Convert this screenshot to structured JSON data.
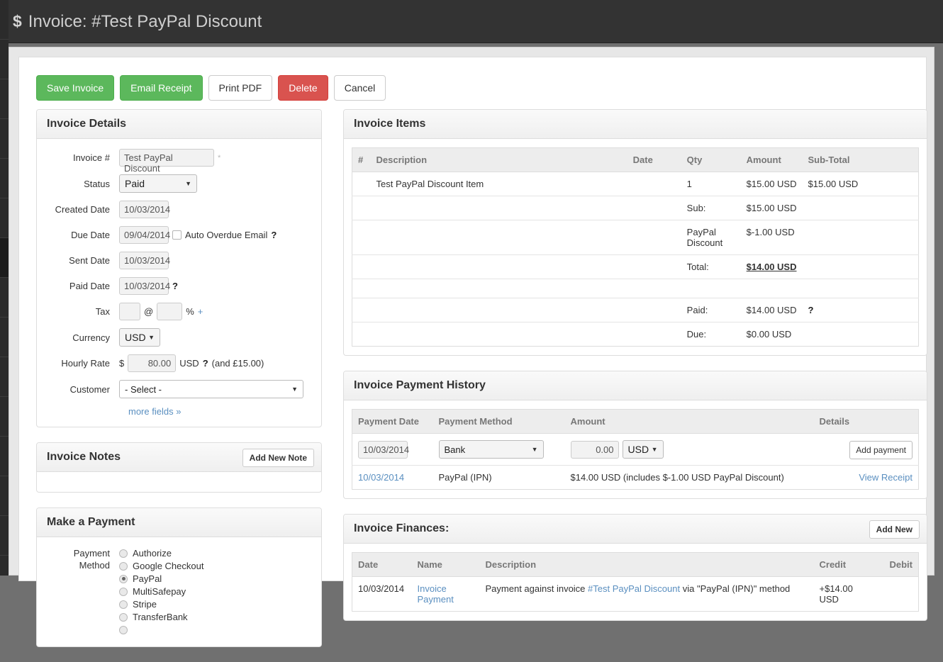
{
  "header": {
    "icon": "dollar-icon",
    "title": "Invoice: #Test PayPal Discount"
  },
  "toolbar": {
    "save_label": "Save Invoice",
    "email_label": "Email Receipt",
    "print_label": "Print PDF",
    "delete_label": "Delete",
    "cancel_label": "Cancel"
  },
  "invoice_details": {
    "panel_title": "Invoice Details",
    "labels": {
      "invoice_no": "Invoice #",
      "status": "Status",
      "created_date": "Created Date",
      "due_date": "Due Date",
      "sent_date": "Sent Date",
      "paid_date": "Paid Date",
      "tax": "Tax",
      "currency": "Currency",
      "hourly_rate": "Hourly Rate",
      "customer": "Customer"
    },
    "values": {
      "invoice_no": "Test PayPal Discount",
      "required_mark": "*",
      "status": "Paid",
      "created_date": "10/03/2014",
      "due_date": "09/04/2014",
      "auto_overdue_label": "Auto Overdue Email",
      "sent_date": "10/03/2014",
      "paid_date": "10/03/2014",
      "tax_amount": "",
      "tax_at": "@",
      "tax_percent": "",
      "tax_percent_sign": "%",
      "tax_add": "+",
      "currency": "USD",
      "rate_prefix": "$",
      "hourly_rate": "80.00",
      "rate_currency": "USD",
      "rate_note": "(and £15.00)",
      "customer": "- Select -",
      "help_mark": "?"
    },
    "more_fields_link": "more fields »"
  },
  "invoice_notes": {
    "panel_title": "Invoice Notes",
    "add_note_label": "Add New Note",
    "notes": []
  },
  "make_payment": {
    "panel_title": "Make a Payment",
    "label_line1": "Payment",
    "label_line2": "Method",
    "methods": [
      {
        "label": "Authorize",
        "selected": false
      },
      {
        "label": "Google Checkout",
        "selected": false
      },
      {
        "label": "PayPal",
        "selected": true
      },
      {
        "label": "MultiSafepay",
        "selected": false
      },
      {
        "label": "Stripe",
        "selected": false
      },
      {
        "label": "TransferBank",
        "selected": false
      }
    ]
  },
  "invoice_items": {
    "panel_title": "Invoice Items",
    "columns": [
      "#",
      "Description",
      "Date",
      "Qty",
      "Amount",
      "Sub-Total"
    ],
    "rows": [
      {
        "num": "",
        "description": "Test PayPal Discount Item",
        "date": "",
        "qty": "1",
        "amount": "$15.00 USD",
        "subtotal": "$15.00 USD"
      },
      {
        "num": "",
        "description": "",
        "date": "",
        "qty": "Sub:",
        "amount": "$15.00 USD",
        "subtotal": ""
      },
      {
        "num": "",
        "description": "",
        "date": "",
        "qty": "PayPal Discount",
        "amount": "$-1.00 USD",
        "subtotal": ""
      },
      {
        "num": "",
        "description": "",
        "date": "",
        "qty": "Total:",
        "amount": "$14.00 USD",
        "subtotal": ""
      },
      {
        "num": "",
        "description": "",
        "date": "",
        "qty": "",
        "amount": "",
        "subtotal": ""
      },
      {
        "num": "",
        "description": "",
        "date": "",
        "qty": "Paid:",
        "amount": "$14.00 USD",
        "subtotal": ""
      },
      {
        "num": "",
        "description": "",
        "date": "",
        "qty": "Due:",
        "amount": "$0.00 USD",
        "subtotal": ""
      }
    ],
    "paid_help_mark": "?"
  },
  "payment_history": {
    "panel_title": "Invoice Payment History",
    "columns": [
      "Payment Date",
      "Payment Method",
      "Amount",
      "Details"
    ],
    "form": {
      "date": "10/03/2014",
      "method": "Bank",
      "amount": "0.00",
      "currency": "USD",
      "add_button": "Add payment"
    },
    "rows": [
      {
        "date": "10/03/2014",
        "method": "PayPal (IPN)",
        "amount": "$14.00 USD (includes $-1.00 USD PayPal Discount)",
        "details": "View Receipt"
      }
    ]
  },
  "invoice_finances": {
    "panel_title": "Invoice Finances:",
    "add_new_label": "Add New",
    "columns": [
      "Date",
      "Name",
      "Description",
      "Credit",
      "Debit"
    ],
    "rows": [
      {
        "date": "10/03/2014",
        "name": "Invoice Payment",
        "desc_before": "Payment against invoice ",
        "desc_link": "#Test PayPal Discount",
        "desc_after": " via \"PayPal (IPN)\" method",
        "credit": "+$14.00 USD",
        "debit": ""
      }
    ]
  },
  "colors": {
    "green": "#5cb85c",
    "red": "#d9534f",
    "link": "#5a8fc0",
    "header_bg": "#333333",
    "page_bg": "#707070"
  }
}
